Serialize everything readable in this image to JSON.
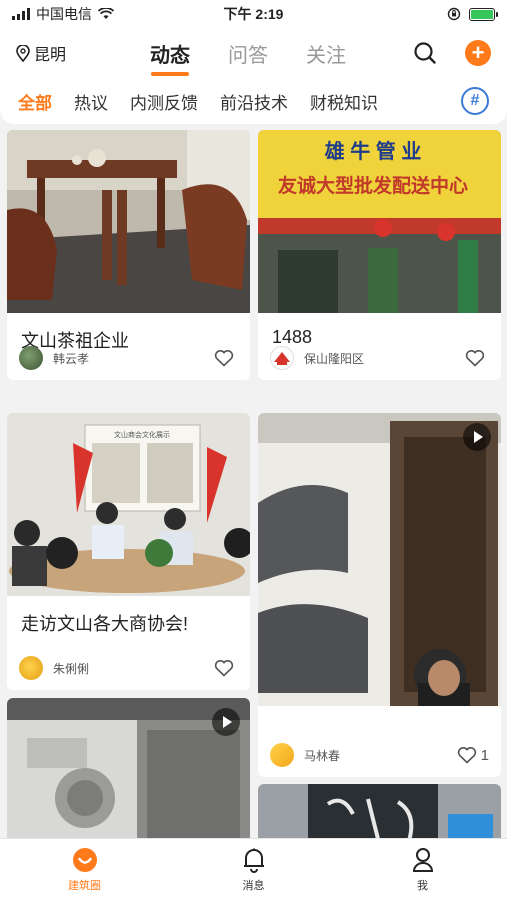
{
  "status_bar": {
    "carrier": "中国电信",
    "time": "下午 2:19"
  },
  "header": {
    "location": "昆明",
    "tabs": [
      {
        "label": "动态",
        "active": true
      },
      {
        "label": "问答",
        "active": false
      },
      {
        "label": "关注",
        "active": false
      }
    ]
  },
  "categories": [
    {
      "label": "全部",
      "active": true
    },
    {
      "label": "热议",
      "active": false
    },
    {
      "label": "内测反馈",
      "active": false
    },
    {
      "label": "前沿技术",
      "active": false
    },
    {
      "label": "财税知识",
      "active": false
    }
  ],
  "sign_text": {
    "line1": "雄 牛 管 业",
    "line2": "友诚大型批发配送中心",
    "exhibit": "文山商会文化展示"
  },
  "cards": [
    {
      "title": "文山茶祖企业",
      "user": "韩云孝",
      "likes": "",
      "video": false
    },
    {
      "title": "1488",
      "user": "保山隆阳区",
      "likes": "",
      "video": false
    },
    {
      "title": "走访文山各大商协会!",
      "user": "朱俐俐",
      "likes": "",
      "video": false
    },
    {
      "title": "",
      "user": "马林春",
      "likes": "1",
      "video": true
    },
    {
      "title": "",
      "user": "",
      "likes": "",
      "video": true
    }
  ],
  "bottom_nav": [
    {
      "label": "建筑圈",
      "active": true,
      "icon": "smile-icon"
    },
    {
      "label": "消息",
      "active": false,
      "icon": "bell-icon"
    },
    {
      "label": "我",
      "active": false,
      "icon": "person-icon"
    }
  ],
  "colors": {
    "accent": "#ff7a1a",
    "hashtag": "#3a7bd5",
    "battery": "#35c759"
  }
}
